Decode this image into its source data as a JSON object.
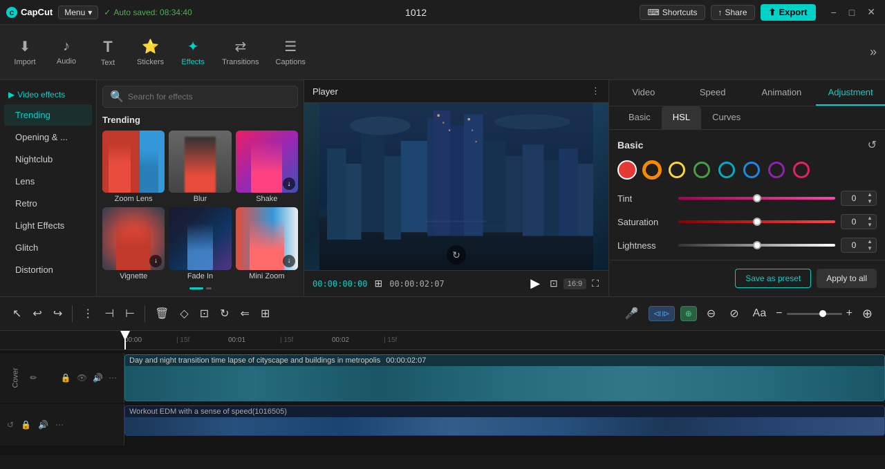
{
  "app": {
    "name": "CapCut",
    "menu_label": "Menu",
    "auto_saved": "Auto saved: 08:34:40",
    "project_title": "1012",
    "shortcuts_label": "Shortcuts",
    "share_label": "Share",
    "export_label": "Export"
  },
  "toolbar": {
    "items": [
      {
        "id": "import",
        "label": "Import",
        "icon": "⬇"
      },
      {
        "id": "audio",
        "label": "Audio",
        "icon": "♪"
      },
      {
        "id": "text",
        "label": "Text",
        "icon": "T"
      },
      {
        "id": "stickers",
        "label": "Stickers",
        "icon": "⭐"
      },
      {
        "id": "effects",
        "label": "Effects",
        "icon": "✦",
        "active": true
      },
      {
        "id": "transitions",
        "label": "Transitions",
        "icon": "⇄"
      },
      {
        "id": "captions",
        "label": "Captions",
        "icon": "☰"
      }
    ],
    "more_label": "»"
  },
  "left_panel": {
    "video_effects_label": "Video effects",
    "nav_items": [
      {
        "id": "trending",
        "label": "Trending",
        "active": true
      },
      {
        "id": "opening",
        "label": "Opening & ..."
      },
      {
        "id": "nightclub",
        "label": "Nightclub"
      },
      {
        "id": "lens",
        "label": "Lens"
      },
      {
        "id": "retro",
        "label": "Retro"
      },
      {
        "id": "light",
        "label": "Light Effects"
      },
      {
        "id": "glitch",
        "label": "Glitch"
      },
      {
        "id": "distortion",
        "label": "Distortion"
      }
    ]
  },
  "effects_panel": {
    "search_placeholder": "Search for effects",
    "trending_label": "Trending",
    "effects": [
      {
        "id": "zoom-lens",
        "name": "Zoom Lens",
        "has_download": false
      },
      {
        "id": "blur",
        "name": "Blur",
        "has_download": false
      },
      {
        "id": "shake",
        "name": "Shake",
        "has_download": true
      },
      {
        "id": "vignette",
        "name": "Vignette",
        "has_download": true
      },
      {
        "id": "fade-in",
        "name": "Fade In",
        "has_download": false
      },
      {
        "id": "mini-zoom",
        "name": "Mini Zoom",
        "has_download": true
      }
    ]
  },
  "player": {
    "title": "Player",
    "current_time": "00:00:00:00",
    "total_time": "00:00:02:07",
    "aspect_ratio": "16:9"
  },
  "right_panel": {
    "tabs": [
      "Video",
      "Speed",
      "Animation",
      "Adjustment"
    ],
    "active_tab": "Adjustment",
    "adjustment_tabs": [
      "Basic",
      "HSL",
      "Curves"
    ],
    "active_adj_tab": "HSL",
    "basic_label": "Basic",
    "colors": [
      {
        "id": "red",
        "color": "#e53935",
        "selected": true
      },
      {
        "id": "orange",
        "color": "#fb8c00"
      },
      {
        "id": "yellow",
        "color": "#fdd835"
      },
      {
        "id": "green",
        "color": "#43a047"
      },
      {
        "id": "cyan",
        "color": "#00acc1"
      },
      {
        "id": "blue",
        "color": "#1e88e5"
      },
      {
        "id": "purple",
        "color": "#8e24aa"
      },
      {
        "id": "magenta",
        "color": "#e91e63"
      }
    ],
    "sliders": [
      {
        "id": "tint",
        "label": "Tint",
        "value": 0,
        "track_style": "pink"
      },
      {
        "id": "saturation",
        "label": "Saturation",
        "value": 0,
        "track_style": "red"
      },
      {
        "id": "lightness",
        "label": "Lightness",
        "value": 0,
        "track_style": "white"
      }
    ],
    "save_preset_label": "Save as preset",
    "apply_all_label": "Apply to all"
  },
  "bottom_toolbar": {
    "tools": [
      {
        "id": "select",
        "icon": "↖",
        "label": "select"
      },
      {
        "id": "undo",
        "icon": "↩",
        "label": "undo"
      },
      {
        "id": "redo",
        "icon": "↪",
        "label": "redo"
      },
      {
        "id": "split",
        "icon": "⋮",
        "label": "split"
      },
      {
        "id": "split2",
        "icon": "⊣",
        "label": "split2"
      },
      {
        "id": "split3",
        "icon": "⊢",
        "label": "split3"
      },
      {
        "id": "delete",
        "icon": "🗑",
        "label": "delete"
      },
      {
        "id": "keyframe",
        "icon": "◇",
        "label": "keyframe"
      },
      {
        "id": "freeze",
        "icon": "⊡",
        "label": "freeze"
      },
      {
        "id": "rotate",
        "icon": "↻",
        "label": "rotate"
      },
      {
        "id": "reverse",
        "icon": "⇐",
        "label": "reverse"
      },
      {
        "id": "crop",
        "icon": "⊞",
        "label": "crop"
      }
    ],
    "zoom_minus": "−",
    "zoom_plus": "+"
  },
  "timeline": {
    "ruler_marks": [
      "00:00",
      "| 15f",
      "00:01",
      "| 15f",
      "00:02",
      "| 15f"
    ],
    "video_track": {
      "label": "Day and night transition time lapse of cityscape and buildings in metropolis",
      "duration": "00:00:02:07",
      "cover_label": "Cover"
    },
    "audio_track": {
      "label": "Workout EDM with a sense of speed(1016505)"
    }
  }
}
